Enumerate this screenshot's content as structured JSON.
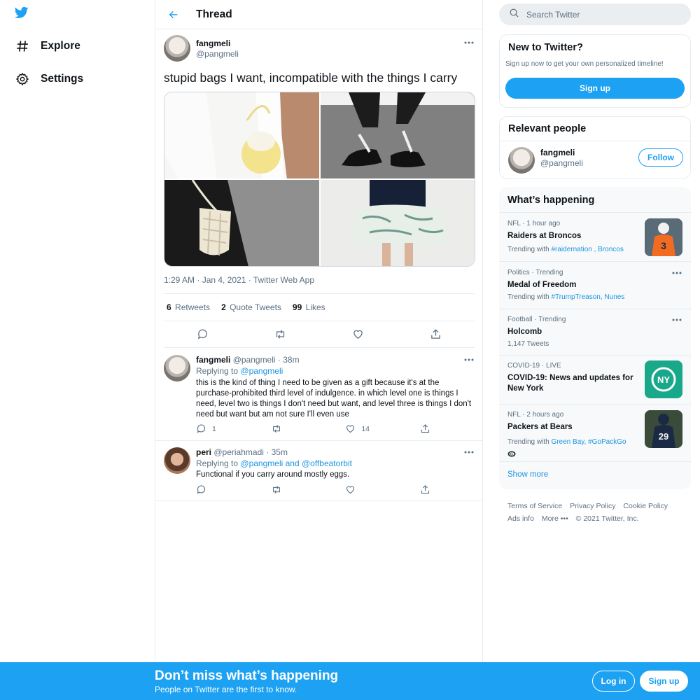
{
  "nav": {
    "items": [
      {
        "label": "Explore",
        "icon": "hashtag-icon"
      },
      {
        "label": "Settings",
        "icon": "gear-icon"
      }
    ]
  },
  "header": {
    "title": "Thread"
  },
  "tweet": {
    "name": "fangmeli",
    "handle": "@pangmeli",
    "text": "stupid bags I want, incompatible with the things I carry",
    "meta": "1:29 AM · Jan 4, 2021 · Twitter Web App",
    "retweets": "6",
    "retweets_label": "Retweets",
    "quotes": "2",
    "quotes_label": "Quote Tweets",
    "likes": "99",
    "likes_label": "Likes"
  },
  "replies": [
    {
      "name": "fangmeli",
      "handle": "@pangmeli",
      "time": "· 38m",
      "replying_prefix": "Replying to",
      "replying_to": "@pangmeli",
      "text": "this is the kind of thing I need to be given as a gift because it's at the purchase-prohibited third level of indulgence. in which level one is things I need, level two is things I don't need but want, and level three is things I don't need but want but am not sure I'll even use",
      "reply_count": "1",
      "retweet_count": "",
      "like_count": "14"
    },
    {
      "name": "peri",
      "handle": "@periahmadi",
      "time": "· 35m",
      "replying_prefix": "Replying to",
      "replying_to": "@pangmeli and @offbeatorbit",
      "text": "Functional if you carry around mostly eggs.",
      "reply_count": "",
      "retweet_count": "",
      "like_count": ""
    }
  ],
  "search": {
    "placeholder": "Search Twitter"
  },
  "new_to_twitter": {
    "title": "New to Twitter?",
    "text": "Sign up now to get your own personalized timeline!",
    "button": "Sign up"
  },
  "relevant": {
    "title": "Relevant people",
    "name": "fangmeli",
    "handle": "@pangmeli",
    "button": "Follow"
  },
  "happening": {
    "title": "What’s happening",
    "trends": [
      {
        "context": "NFL · 1 hour ago",
        "title": "Raiders at Broncos",
        "sub_prefix": "Trending with",
        "sub_links": "#raidernation , Broncos"
      },
      {
        "context": "Politics · Trending",
        "title": "Medal of Freedom",
        "sub_prefix": "Trending with",
        "sub_links": "#TrumpTreason, Nunes"
      },
      {
        "context": "Football · Trending",
        "title": "Holcomb",
        "sub_prefix": "1,147 Tweets",
        "sub_links": ""
      },
      {
        "context": "COVID-19 · LIVE",
        "title": "COVID-19: News and updates for New York",
        "sub_prefix": "",
        "sub_links": ""
      },
      {
        "context": "NFL · 2 hours ago",
        "title": "Packers at Bears",
        "sub_prefix": "Trending with",
        "sub_links": "Green Bay, #GoPackGo"
      }
    ],
    "show_more": "Show more",
    "thumb_ny_text": "NY",
    "thumb_player1_number": "3",
    "thumb_player2_number": "29"
  },
  "footer": {
    "links": [
      "Terms of Service",
      "Privacy Policy",
      "Cookie Policy",
      "Ads info",
      "More •••",
      "© 2021 Twitter, Inc."
    ]
  },
  "bottombar": {
    "heading": "Don’t miss what’s happening",
    "sub": "People on Twitter are the first to know.",
    "login": "Log in",
    "signup": "Sign up"
  },
  "colors": {
    "accent": "#1da1f2",
    "link": "#1b95e0",
    "text": "#0f1419",
    "muted": "#5b7083"
  }
}
